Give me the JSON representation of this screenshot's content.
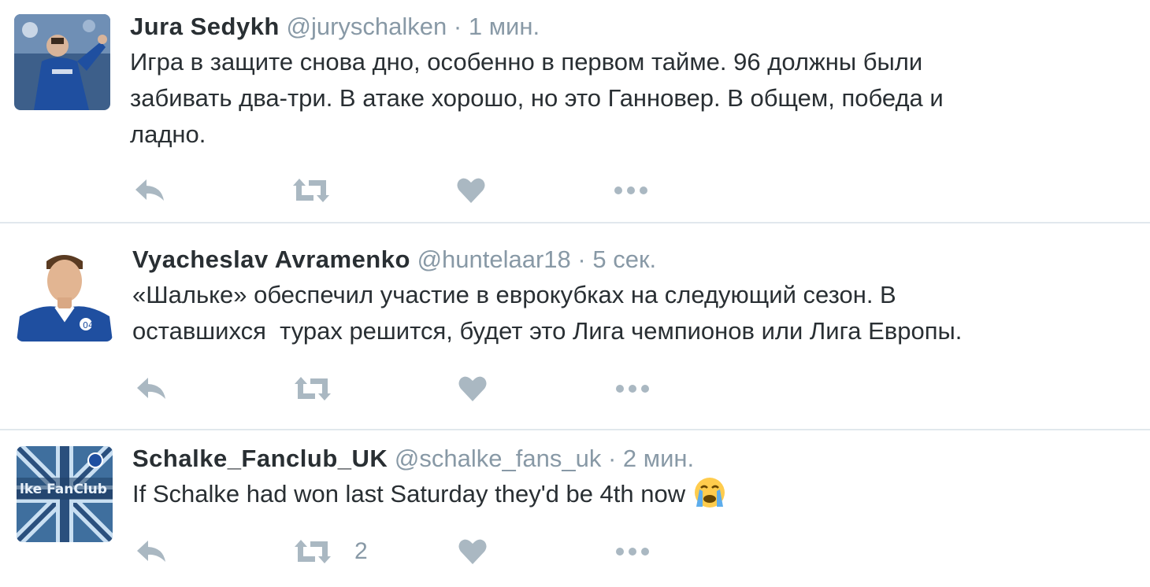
{
  "tweets": [
    {
      "fullname": "Jura Sedykh",
      "username": "@juryschalken",
      "separator": "·",
      "time": "1 мин.",
      "text": "Игра в защите снова дно, особенно в первом тайме. 96 должны были\nзабивать два-три. В атаке хорошо, но это Ганновер. В общем, победа и\nладно.",
      "retweet_count": ""
    },
    {
      "fullname": "Vyacheslav Avramenko",
      "username": "@huntelaar18",
      "separator": "·",
      "time": "5 сек.",
      "text": "«Шальке» обеспечил участие в еврокубках на следующий сезон. В\nоставшихся  турах решится, будет это Лига чемпионов или Лига Европы.",
      "retweet_count": ""
    },
    {
      "fullname": "Schalke_Fanclub_UK",
      "username": "@schalke_fans_uk",
      "separator": "·",
      "time": "2 мин.",
      "text": "If Schalke had won last Saturday they'd be 4th now",
      "emoji": "crying-face-emoji",
      "retweet_count": "2"
    }
  ],
  "icons": {
    "reply": "reply-icon",
    "retweet": "retweet-icon",
    "like": "heart-icon",
    "more": "more-dots-icon"
  },
  "colors": {
    "text": "#292f33",
    "meta": "#8899a6",
    "action_icon": "#aab8c2",
    "divider": "#e1e8ed",
    "schalke_blue": "#1f4fa0"
  }
}
